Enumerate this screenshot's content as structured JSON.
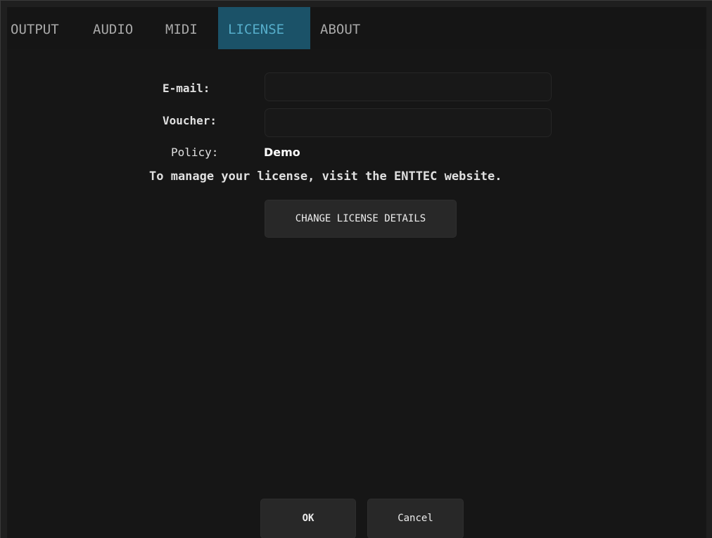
{
  "tabs": [
    {
      "label": "OUTPUT",
      "active": false
    },
    {
      "label": "AUDIO",
      "active": false
    },
    {
      "label": "MIDI",
      "active": false
    },
    {
      "label": "LICENSE",
      "active": true
    },
    {
      "label": "ABOUT",
      "active": false
    }
  ],
  "license": {
    "email_label": "E-mail:",
    "email_value": "",
    "voucher_label": "Voucher:",
    "voucher_value": "",
    "policy_label": "Policy:",
    "policy_value": "Demo",
    "manage_text": "To manage your license, visit the ENTTEC website.",
    "change_button": "CHANGE LICENSE DETAILS"
  },
  "footer": {
    "ok_label": "OK",
    "cancel_label": "Cancel"
  },
  "colors": {
    "active_tab_bg": "#1b5268",
    "active_tab_text": "#56aecb",
    "background": "#161616"
  }
}
